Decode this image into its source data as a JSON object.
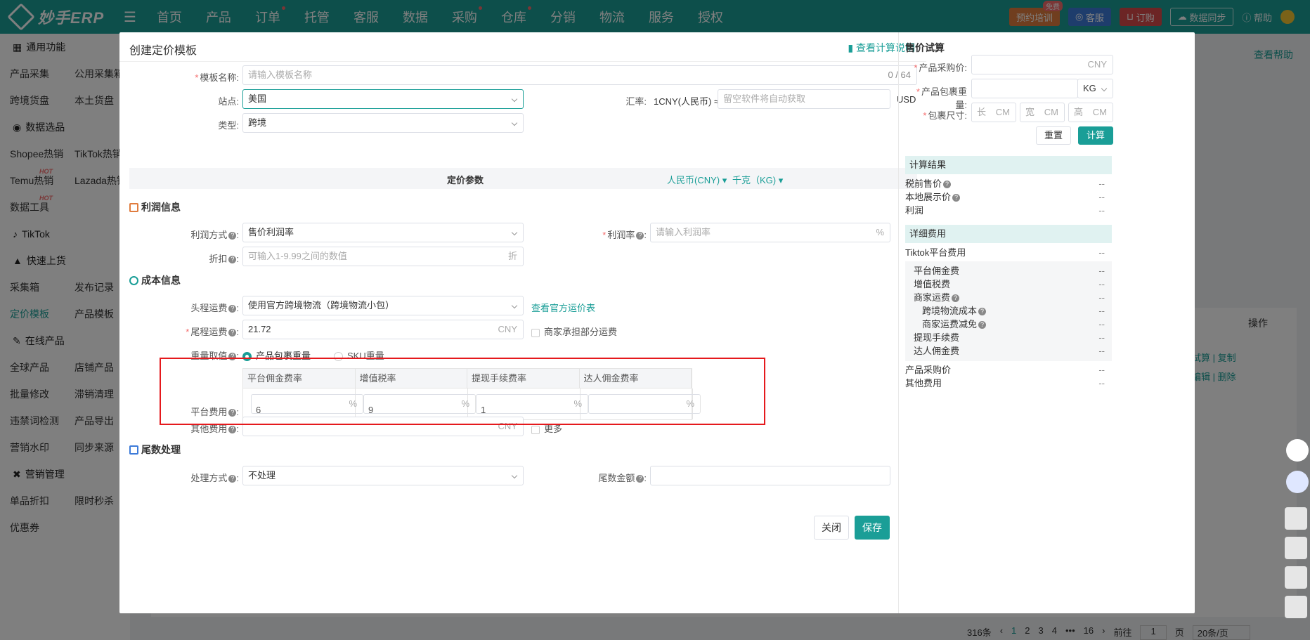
{
  "nav": {
    "logo": "妙手ERP",
    "menu": [
      "首页",
      "产品",
      "订单",
      "托管",
      "客服",
      "数据",
      "采购",
      "仓库",
      "分销",
      "物流",
      "服务",
      "授权"
    ],
    "right": {
      "train": "预约培训",
      "train_tag": "免费",
      "service": "客服",
      "order": "订购",
      "sync": "数据同步",
      "help": "帮助"
    }
  },
  "sidebar": {
    "general": "通用功能",
    "row1": [
      "产品采集",
      "公用采集箱"
    ],
    "row2": [
      "跨境货盘",
      "本土货盘"
    ],
    "data_select": "数据选品",
    "row3": [
      "Shopee热销",
      "TikTok热销"
    ],
    "row4": [
      "Temu热销",
      "Lazada热销"
    ],
    "row5": [
      "数据工具"
    ],
    "hot": "HOT",
    "tiktok": "TikTok",
    "quick": "快速上货",
    "row6": [
      "采集箱",
      "发布记录"
    ],
    "row7": [
      "定价模板",
      "产品模板"
    ],
    "online": "在线产品",
    "row8": [
      "全球产品",
      "店铺产品"
    ],
    "row9": [
      "批量修改",
      "滞销清理"
    ],
    "row10": [
      "违禁词检测",
      "产品导出"
    ],
    "row11": [
      "营销水印",
      "同步来源"
    ],
    "marketing": "营销管理",
    "row12": [
      "单品折扣",
      "限时秒杀"
    ],
    "row13": [
      "优惠券"
    ]
  },
  "bg": {
    "help": "查看帮助",
    "action_header": "操作",
    "actions": [
      "试算",
      "复制",
      "编辑",
      "删除"
    ],
    "pagination": {
      "total": "316条",
      "pages": [
        "1",
        "2",
        "3",
        "4",
        "•••",
        "16"
      ],
      "goto": "前往",
      "page": "1",
      "page_unit": "页",
      "size": "20条/页"
    }
  },
  "dialog": {
    "title": "创建定价模板",
    "calc_link": "查看计算说明",
    "template_name": {
      "label": "模板名称:",
      "placeholder": "请输入模板名称",
      "count": "0 / 64"
    },
    "site": {
      "label": "站点:",
      "value": "美国"
    },
    "rate": {
      "label": "汇率:",
      "text": "1CNY(人民币) ≈",
      "placeholder": "留空软件将自动获取",
      "unit": "USD"
    },
    "type": {
      "label": "类型:",
      "value": "跨境"
    },
    "params": {
      "title": "定价参数",
      "currency": "人民币(CNY)",
      "weight_unit": "千克（KG)"
    },
    "profit": {
      "section": "利润信息",
      "method_label": "利润方式",
      "method_value": "售价利润率",
      "rate_label": "利润率",
      "rate_placeholder": "请输入利润率",
      "rate_unit": "%",
      "discount_label": "折扣",
      "discount_placeholder": "可输入1-9.99之间的数值",
      "discount_unit": "折"
    },
    "cost": {
      "section": "成本信息",
      "head_label": "头程运费",
      "head_value": "使用官方跨境物流（跨境物流小包）",
      "head_link": "查看官方运价表",
      "tail_label": "尾程运费",
      "tail_value": "21.72",
      "tail_unit": "CNY",
      "merchant": "商家承担部分运费",
      "weight_label": "重量取值",
      "weight_opt1": "产品包裹重量",
      "weight_opt2": "SKU重量",
      "platform_label": "平台费用",
      "cols": [
        "平台佣金费率",
        "增值税率",
        "提现手续费率",
        "达人佣金费率"
      ],
      "vals": [
        "6",
        "9",
        "1",
        ""
      ],
      "pct": "%",
      "other_label": "其他费用",
      "other_unit": "CNY",
      "more": "更多"
    },
    "tail": {
      "section": "尾数处理",
      "method_label": "处理方式",
      "method_value": "不处理",
      "amount_label": "尾数金额"
    },
    "close": "关闭",
    "save": "保存"
  },
  "trial": {
    "title": "售价试算",
    "purchase_label": "产品采购价:",
    "purchase_unit": "CNY",
    "weight_label": "产品包裹重量:",
    "weight_unit": "KG",
    "size_label": "包裹尺寸:",
    "size_l": "长",
    "size_w": "宽",
    "size_h": "高",
    "size_unit": "CM",
    "reset": "重置",
    "calc": "计算",
    "result_title": "计算结果",
    "pretax": "税前售价",
    "local": "本地展示价",
    "profit": "利润",
    "detail_title": "详细费用",
    "tiktok_fee": "Tiktok平台费用",
    "items": [
      "平台佣金费",
      "增值税费",
      "商家运费",
      "跨境物流成本",
      "商家运费减免",
      "提现手续费",
      "达人佣金费"
    ],
    "purchase": "产品采购价",
    "other": "其他费用",
    "dash": "--"
  }
}
